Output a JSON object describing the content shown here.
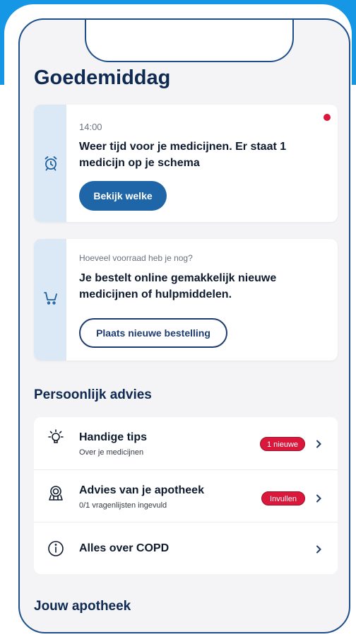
{
  "greeting": "Goedemiddag",
  "reminder_card": {
    "time": "14:00",
    "message": "Weer tijd voor je medicijnen. Er staat 1 medicijn op je schema",
    "button_label": "Bekijk welke",
    "icon": "alarm-clock-icon",
    "unread_dot_color": "#d9183b"
  },
  "order_card": {
    "question": "Hoeveel voorraad heb je nog?",
    "message": "Je bestelt online gemakkelijk nieuwe medicijnen of hulpmiddelen.",
    "button_label": "Plaats nieuwe bestelling",
    "icon": "shopping-cart-icon"
  },
  "personal_advice": {
    "title": "Persoonlijk advies",
    "items": [
      {
        "title": "Handige tips",
        "subtitle": "Over je medicijnen",
        "badge": "1 nieuwe",
        "icon": "lightbulb-icon"
      },
      {
        "title": "Advies van je apotheek",
        "subtitle": "0/1 vragenlijsten ingevuld",
        "badge": "Invullen",
        "icon": "pharmacist-icon"
      },
      {
        "title": "Alles over COPD",
        "subtitle": "",
        "badge": "",
        "icon": "info-icon"
      }
    ]
  },
  "your_pharmacy": {
    "title": "Jouw apotheek"
  },
  "colors": {
    "accent": "#1f66a8",
    "badge": "#d9183b",
    "frame": "#1597e5"
  }
}
